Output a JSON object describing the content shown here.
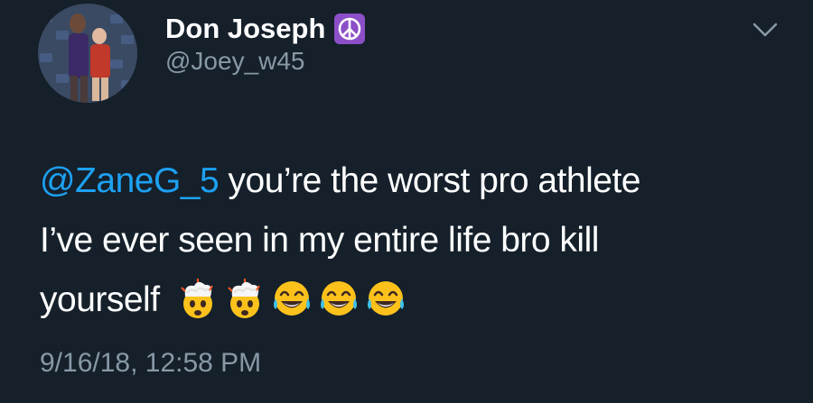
{
  "tweet": {
    "display_name": "Don Joseph",
    "badge_icon": "peace-symbol-icon",
    "badge_color": "#8c4fc7",
    "handle": "@Joey_w45",
    "mention": "@ZaneG_5",
    "body_text_line1": "you’re the worst pro athlete",
    "body_text_line2": "I’ve ever seen in my entire life bro kill",
    "body_text_line3": "yourself",
    "emojis": [
      "exploding-head-icon",
      "exploding-head-icon",
      "tears-of-joy-icon",
      "tears-of-joy-icon",
      "tears-of-joy-icon"
    ],
    "timestamp": "9/16/18, 12:58 PM"
  },
  "colors": {
    "background": "#15202b",
    "text": "#ffffff",
    "secondary": "#8899a6",
    "link": "#1da1f2"
  }
}
